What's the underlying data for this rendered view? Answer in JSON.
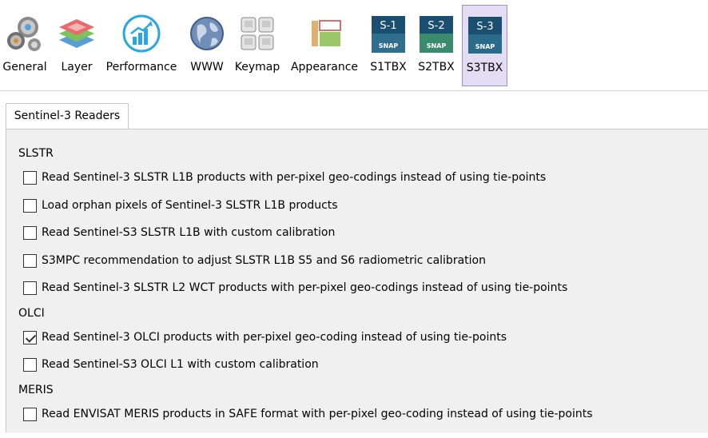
{
  "toolbar": {
    "items": [
      {
        "label": "General",
        "icon": "gears-icon"
      },
      {
        "label": "Layer",
        "icon": "layers-icon"
      },
      {
        "label": "Performance",
        "icon": "performance-chart-icon"
      },
      {
        "label": "WWW",
        "icon": "globe-icon"
      },
      {
        "label": "Keymap",
        "icon": "keyboard-keys-icon"
      },
      {
        "label": "Appearance",
        "icon": "appearance-layout-icon"
      },
      {
        "label": "S1TBX",
        "icon": "s1-snap-icon",
        "badge": "S-1"
      },
      {
        "label": "S2TBX",
        "icon": "s2-snap-icon",
        "badge": "S-2"
      },
      {
        "label": "S3TBX",
        "icon": "s3-snap-icon",
        "badge": "S-3",
        "selected": true
      }
    ]
  },
  "tab": {
    "label": "Sentinel-3 Readers"
  },
  "groups": {
    "slstr": {
      "label": "SLSTR",
      "options": [
        {
          "label": "Read Sentinel-3 SLSTR L1B products with per-pixel geo-codings instead of using tie-points",
          "checked": false
        },
        {
          "label": "Load orphan pixels of Sentinel-3 SLSTR L1B products",
          "checked": false
        },
        {
          "label": "Read Sentinel-S3 SLSTR L1B with custom calibration",
          "checked": false
        },
        {
          "label": "S3MPC recommendation to adjust SLSTR L1B S5 and S6 radiometric calibration",
          "checked": false
        },
        {
          "label": "Read Sentinel-3 SLSTR L2 WCT products with per-pixel geo-codings instead of using tie-points",
          "checked": false
        }
      ]
    },
    "olci": {
      "label": "OLCI",
      "options": [
        {
          "label": "Read Sentinel-3 OLCI products with per-pixel geo-coding instead of using tie-points",
          "checked": true
        },
        {
          "label": "Read Sentinel-S3 OLCI L1 with custom calibration",
          "checked": false
        }
      ]
    },
    "meris": {
      "label": "MERIS",
      "options": [
        {
          "label": "Read ENVISAT MERIS products in SAFE format with per-pixel geo-coding instead of using tie-points",
          "checked": false
        }
      ]
    }
  },
  "colors": {
    "selected_bg": "#e3ddf3",
    "selected_border": "#9f8fd1",
    "panel_bg": "#f0f0f0",
    "snap_tile": "#1a4f72"
  }
}
